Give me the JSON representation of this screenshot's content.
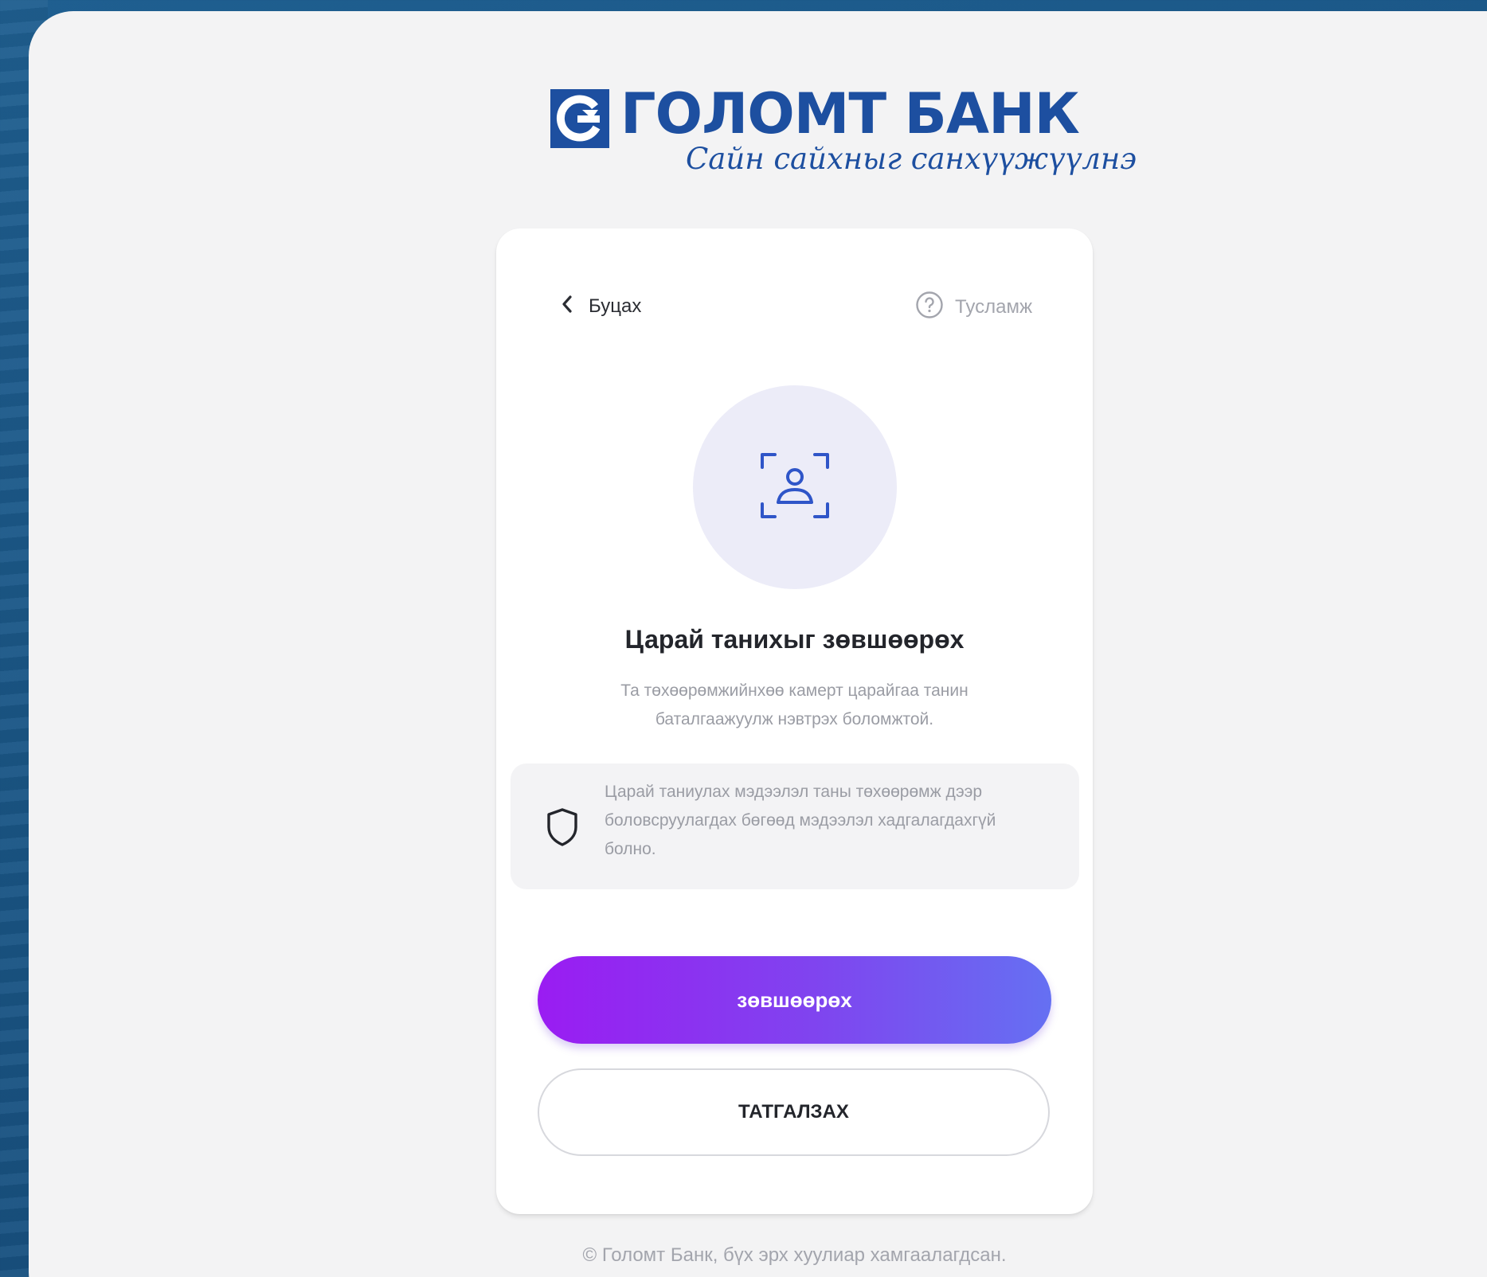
{
  "brand": {
    "name": "ГОЛОМТ БАНК",
    "slogan": "Сайн сайхныг санхүүжүүлнэ",
    "color": "#1d4fa0"
  },
  "nav": {
    "back_label": "Буцах",
    "help_label": "Тусламж"
  },
  "icons": {
    "back": "chevron-left-icon",
    "help": "question-circle-icon",
    "face": "face-scan-icon",
    "shield": "shield-icon"
  },
  "content": {
    "title": "Царай танихыг зөвшөөрөх",
    "description": "Та төхөөрөмжийнхөө камерт царайгаа танин баталгаажуулж нэвтрэх боломжтой.",
    "info": "Царай таниулах мэдээлэл таны төхөөрөмж дээр боловсруулагдах бөгөөд мэдээлэл хадгалагдахгүй болно."
  },
  "actions": {
    "allow_label": "зөвшөөрөх",
    "decline_label": "ТАТГАЛЗАХ"
  },
  "footer": {
    "copyright": "© Голомт Банк, бүх эрх хуулиар хамгаалагдсан."
  },
  "colors": {
    "accent_start": "#9a1cf2",
    "accent_end": "#6570f2",
    "face_icon": "#2f55c8"
  }
}
